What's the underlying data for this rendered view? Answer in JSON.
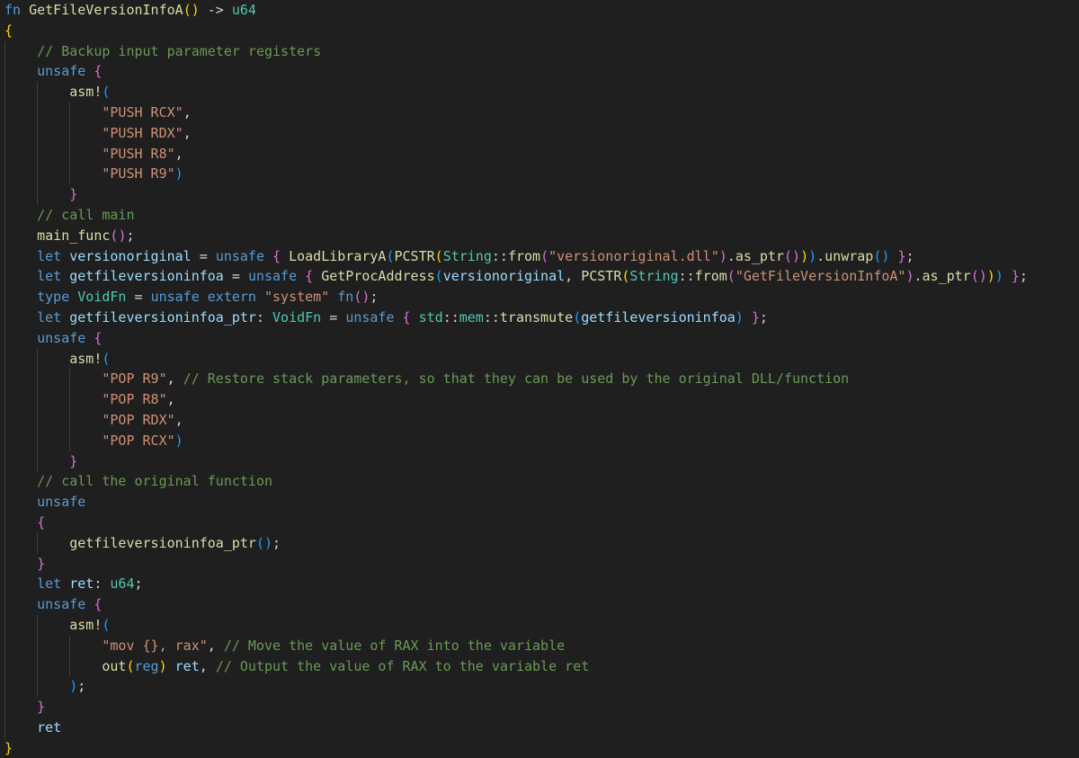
{
  "editor": {
    "language": "rust",
    "theme": "dark",
    "colors": {
      "background": "#1f1f1f",
      "keyword": "#569cd6",
      "function": "#dcdcaa",
      "type": "#4ec9b0",
      "variable": "#9cdcfe",
      "string": "#ce9178",
      "comment": "#6a9955",
      "bracket_level1": "#ffd700",
      "bracket_level2": "#da70d6",
      "bracket_level3": "#179fff"
    },
    "lines": [
      {
        "indent": 0,
        "tokens": [
          [
            "fn",
            "kw"
          ],
          [
            " ",
            "pl"
          ],
          [
            "GetFileVersionInfoA",
            "fn"
          ],
          [
            "(",
            "b1"
          ],
          [
            ")",
            "b1"
          ],
          [
            " -> ",
            "op"
          ],
          [
            "u64",
            "ty"
          ]
        ]
      },
      {
        "indent": 0,
        "tokens": [
          [
            "{",
            "b1"
          ]
        ]
      },
      {
        "indent": 1,
        "tokens": [
          [
            "// Backup input parameter registers",
            "cm"
          ]
        ]
      },
      {
        "indent": 1,
        "tokens": [
          [
            "unsafe",
            "kw"
          ],
          [
            " ",
            "pl"
          ],
          [
            "{",
            "b2"
          ]
        ]
      },
      {
        "indent": 2,
        "tokens": [
          [
            "asm!",
            "fn"
          ],
          [
            "(",
            "b3"
          ]
        ]
      },
      {
        "indent": 3,
        "tokens": [
          [
            "\"PUSH RCX\"",
            "str"
          ],
          [
            ",",
            "pl"
          ]
        ]
      },
      {
        "indent": 3,
        "tokens": [
          [
            "\"PUSH RDX\"",
            "str"
          ],
          [
            ",",
            "pl"
          ]
        ]
      },
      {
        "indent": 3,
        "tokens": [
          [
            "\"PUSH R8\"",
            "str"
          ],
          [
            ",",
            "pl"
          ]
        ]
      },
      {
        "indent": 3,
        "tokens": [
          [
            "\"PUSH R9\"",
            "str"
          ],
          [
            ")",
            "b3"
          ]
        ]
      },
      {
        "indent": 2,
        "tokens": [
          [
            "}",
            "b2"
          ]
        ]
      },
      {
        "indent": 1,
        "tokens": [
          [
            "// call main",
            "cm"
          ]
        ]
      },
      {
        "indent": 1,
        "tokens": [
          [
            "main_func",
            "fn"
          ],
          [
            "(",
            "b2"
          ],
          [
            ")",
            "b2"
          ],
          [
            ";",
            "pl"
          ]
        ]
      },
      {
        "indent": 1,
        "tokens": [
          [
            "let",
            "kw"
          ],
          [
            " ",
            "pl"
          ],
          [
            "versionoriginal",
            "var"
          ],
          [
            " = ",
            "op"
          ],
          [
            "unsafe",
            "kw"
          ],
          [
            " ",
            "pl"
          ],
          [
            "{",
            "b2"
          ],
          [
            " ",
            "pl"
          ],
          [
            "LoadLibraryA",
            "fn"
          ],
          [
            "(",
            "b3"
          ],
          [
            "PCSTR",
            "fn"
          ],
          [
            "(",
            "b1"
          ],
          [
            "String",
            "ty"
          ],
          [
            "::",
            "op"
          ],
          [
            "from",
            "fn"
          ],
          [
            "(",
            "b2"
          ],
          [
            "\"versionoriginal.dll\"",
            "str"
          ],
          [
            ")",
            "b2"
          ],
          [
            ".",
            "op"
          ],
          [
            "as_ptr",
            "fn"
          ],
          [
            "(",
            "b2"
          ],
          [
            ")",
            "b2"
          ],
          [
            ")",
            "b1"
          ],
          [
            ")",
            "b3"
          ],
          [
            ".",
            "op"
          ],
          [
            "unwrap",
            "fn"
          ],
          [
            "(",
            "b3"
          ],
          [
            ")",
            "b3"
          ],
          [
            " ",
            "pl"
          ],
          [
            "}",
            "b2"
          ],
          [
            ";",
            "pl"
          ]
        ]
      },
      {
        "indent": 1,
        "tokens": [
          [
            "let",
            "kw"
          ],
          [
            " ",
            "pl"
          ],
          [
            "getfileversioninfoa",
            "var"
          ],
          [
            " = ",
            "op"
          ],
          [
            "unsafe",
            "kw"
          ],
          [
            " ",
            "pl"
          ],
          [
            "{",
            "b2"
          ],
          [
            " ",
            "pl"
          ],
          [
            "GetProcAddress",
            "fn"
          ],
          [
            "(",
            "b3"
          ],
          [
            "versionoriginal",
            "var"
          ],
          [
            ", ",
            "pl"
          ],
          [
            "PCSTR",
            "fn"
          ],
          [
            "(",
            "b1"
          ],
          [
            "String",
            "ty"
          ],
          [
            "::",
            "op"
          ],
          [
            "from",
            "fn"
          ],
          [
            "(",
            "b2"
          ],
          [
            "\"GetFileVersionInfoA\"",
            "str"
          ],
          [
            ")",
            "b2"
          ],
          [
            ".",
            "op"
          ],
          [
            "as_ptr",
            "fn"
          ],
          [
            "(",
            "b2"
          ],
          [
            ")",
            "b2"
          ],
          [
            ")",
            "b1"
          ],
          [
            ")",
            "b3"
          ],
          [
            " ",
            "pl"
          ],
          [
            "}",
            "b2"
          ],
          [
            ";",
            "pl"
          ]
        ]
      },
      {
        "indent": 1,
        "tokens": [
          [
            "type",
            "kw"
          ],
          [
            " ",
            "pl"
          ],
          [
            "VoidFn",
            "ty"
          ],
          [
            " = ",
            "op"
          ],
          [
            "unsafe",
            "kw"
          ],
          [
            " ",
            "pl"
          ],
          [
            "extern",
            "kw"
          ],
          [
            " ",
            "pl"
          ],
          [
            "\"system\"",
            "str"
          ],
          [
            " ",
            "pl"
          ],
          [
            "fn",
            "kw"
          ],
          [
            "(",
            "b2"
          ],
          [
            ")",
            "b2"
          ],
          [
            ";",
            "pl"
          ]
        ]
      },
      {
        "indent": 1,
        "tokens": [
          [
            "let",
            "kw"
          ],
          [
            " ",
            "pl"
          ],
          [
            "getfileversioninfoa_ptr",
            "var"
          ],
          [
            ": ",
            "pl"
          ],
          [
            "VoidFn",
            "ty"
          ],
          [
            " = ",
            "op"
          ],
          [
            "unsafe",
            "kw"
          ],
          [
            " ",
            "pl"
          ],
          [
            "{",
            "b2"
          ],
          [
            " ",
            "pl"
          ],
          [
            "std",
            "ty"
          ],
          [
            "::",
            "op"
          ],
          [
            "mem",
            "ty"
          ],
          [
            "::",
            "op"
          ],
          [
            "transmute",
            "fn"
          ],
          [
            "(",
            "b3"
          ],
          [
            "getfileversioninfoa",
            "var"
          ],
          [
            ")",
            "b3"
          ],
          [
            " ",
            "pl"
          ],
          [
            "}",
            "b2"
          ],
          [
            ";",
            "pl"
          ]
        ]
      },
      {
        "indent": 1,
        "tokens": [
          [
            "unsafe",
            "kw"
          ],
          [
            " ",
            "pl"
          ],
          [
            "{",
            "b2"
          ]
        ]
      },
      {
        "indent": 2,
        "tokens": [
          [
            "asm!",
            "fn"
          ],
          [
            "(",
            "b3"
          ]
        ]
      },
      {
        "indent": 3,
        "tokens": [
          [
            "\"POP R9\"",
            "str"
          ],
          [
            ", ",
            "pl"
          ],
          [
            "// Restore stack parameters, so that they can be used by the original DLL/function",
            "cm"
          ]
        ]
      },
      {
        "indent": 3,
        "tokens": [
          [
            "\"POP R8\"",
            "str"
          ],
          [
            ",",
            "pl"
          ]
        ]
      },
      {
        "indent": 3,
        "tokens": [
          [
            "\"POP RDX\"",
            "str"
          ],
          [
            ",",
            "pl"
          ]
        ]
      },
      {
        "indent": 3,
        "tokens": [
          [
            "\"POP RCX\"",
            "str"
          ],
          [
            ")",
            "b3"
          ]
        ]
      },
      {
        "indent": 2,
        "tokens": [
          [
            "}",
            "b2"
          ]
        ]
      },
      {
        "indent": 1,
        "tokens": [
          [
            "// call the original function",
            "cm"
          ]
        ]
      },
      {
        "indent": 1,
        "tokens": [
          [
            "unsafe",
            "kw"
          ]
        ]
      },
      {
        "indent": 1,
        "tokens": [
          [
            "{",
            "b2"
          ]
        ]
      },
      {
        "indent": 2,
        "tokens": [
          [
            "getfileversioninfoa_ptr",
            "fn"
          ],
          [
            "(",
            "b3"
          ],
          [
            ")",
            "b3"
          ],
          [
            ";",
            "pl"
          ]
        ]
      },
      {
        "indent": 1,
        "tokens": [
          [
            "}",
            "b2"
          ]
        ]
      },
      {
        "indent": 1,
        "tokens": [
          [
            "let",
            "kw"
          ],
          [
            " ",
            "pl"
          ],
          [
            "ret",
            "var"
          ],
          [
            ": ",
            "pl"
          ],
          [
            "u64",
            "ty"
          ],
          [
            ";",
            "pl"
          ]
        ]
      },
      {
        "indent": 1,
        "tokens": [
          [
            "unsafe",
            "kw"
          ],
          [
            " ",
            "pl"
          ],
          [
            "{",
            "b2"
          ]
        ]
      },
      {
        "indent": 2,
        "tokens": [
          [
            "asm!",
            "fn"
          ],
          [
            "(",
            "b3"
          ]
        ]
      },
      {
        "indent": 3,
        "tokens": [
          [
            "\"mov {}, rax\"",
            "str"
          ],
          [
            ", ",
            "pl"
          ],
          [
            "// Move the value of RAX into the variable",
            "cm"
          ]
        ]
      },
      {
        "indent": 3,
        "tokens": [
          [
            "out",
            "fn"
          ],
          [
            "(",
            "b1"
          ],
          [
            "reg",
            "kw"
          ],
          [
            ")",
            "b1"
          ],
          [
            " ",
            "pl"
          ],
          [
            "ret",
            "var"
          ],
          [
            ", ",
            "pl"
          ],
          [
            "// Output the value of RAX to the variable ret",
            "cm"
          ]
        ]
      },
      {
        "indent": 2,
        "tokens": [
          [
            ")",
            "b3"
          ],
          [
            ";",
            "pl"
          ]
        ]
      },
      {
        "indent": 1,
        "tokens": [
          [
            "}",
            "b2"
          ]
        ]
      },
      {
        "indent": 1,
        "tokens": [
          [
            "ret",
            "var"
          ]
        ]
      },
      {
        "indent": 0,
        "tokens": [
          [
            "}",
            "b1"
          ]
        ]
      }
    ]
  }
}
